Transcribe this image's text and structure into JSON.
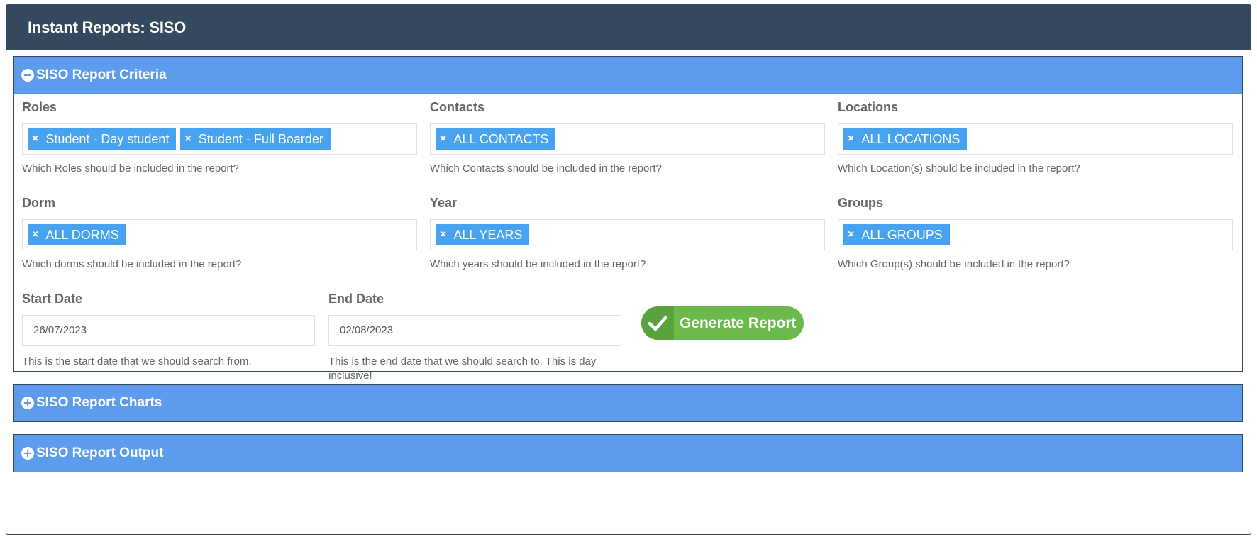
{
  "header": {
    "title": "Instant Reports: SISO"
  },
  "criteria": {
    "title": "SISO Report Criteria",
    "roles": {
      "label": "Roles",
      "tags": [
        "Student - Day student",
        "Student - Full Boarder"
      ],
      "help": "Which Roles should be included in the report?"
    },
    "contacts": {
      "label": "Contacts",
      "tags": [
        "ALL CONTACTS"
      ],
      "help": "Which Contacts should be included in the report?"
    },
    "locations": {
      "label": "Locations",
      "tags": [
        "ALL LOCATIONS"
      ],
      "help": "Which Location(s) should be included in the report?"
    },
    "dorm": {
      "label": "Dorm",
      "tags": [
        "ALL DORMS"
      ],
      "help": "Which dorms should be included in the report?"
    },
    "year": {
      "label": "Year",
      "tags": [
        "ALL YEARS"
      ],
      "help": "Which years should be included in the report?"
    },
    "groups": {
      "label": "Groups",
      "tags": [
        "ALL GROUPS"
      ],
      "help": "Which Group(s) should be included in the report?"
    },
    "start_date": {
      "label": "Start Date",
      "value": "26/07/2023",
      "help": "This is the start date that we should search from."
    },
    "end_date": {
      "label": "End Date",
      "value": "02/08/2023",
      "help": "This is the end date that we should search to. This is day inclusive!"
    },
    "generate_label": "Generate Report",
    "tag_remove": "×"
  },
  "charts": {
    "title": "SISO Report Charts"
  },
  "output": {
    "title": "SISO Report Output"
  },
  "colors": {
    "header_bg": "#34495e",
    "section_bg": "#5d9cec",
    "tag_bg": "#47a3f0",
    "button_green": "#6cb94b"
  }
}
